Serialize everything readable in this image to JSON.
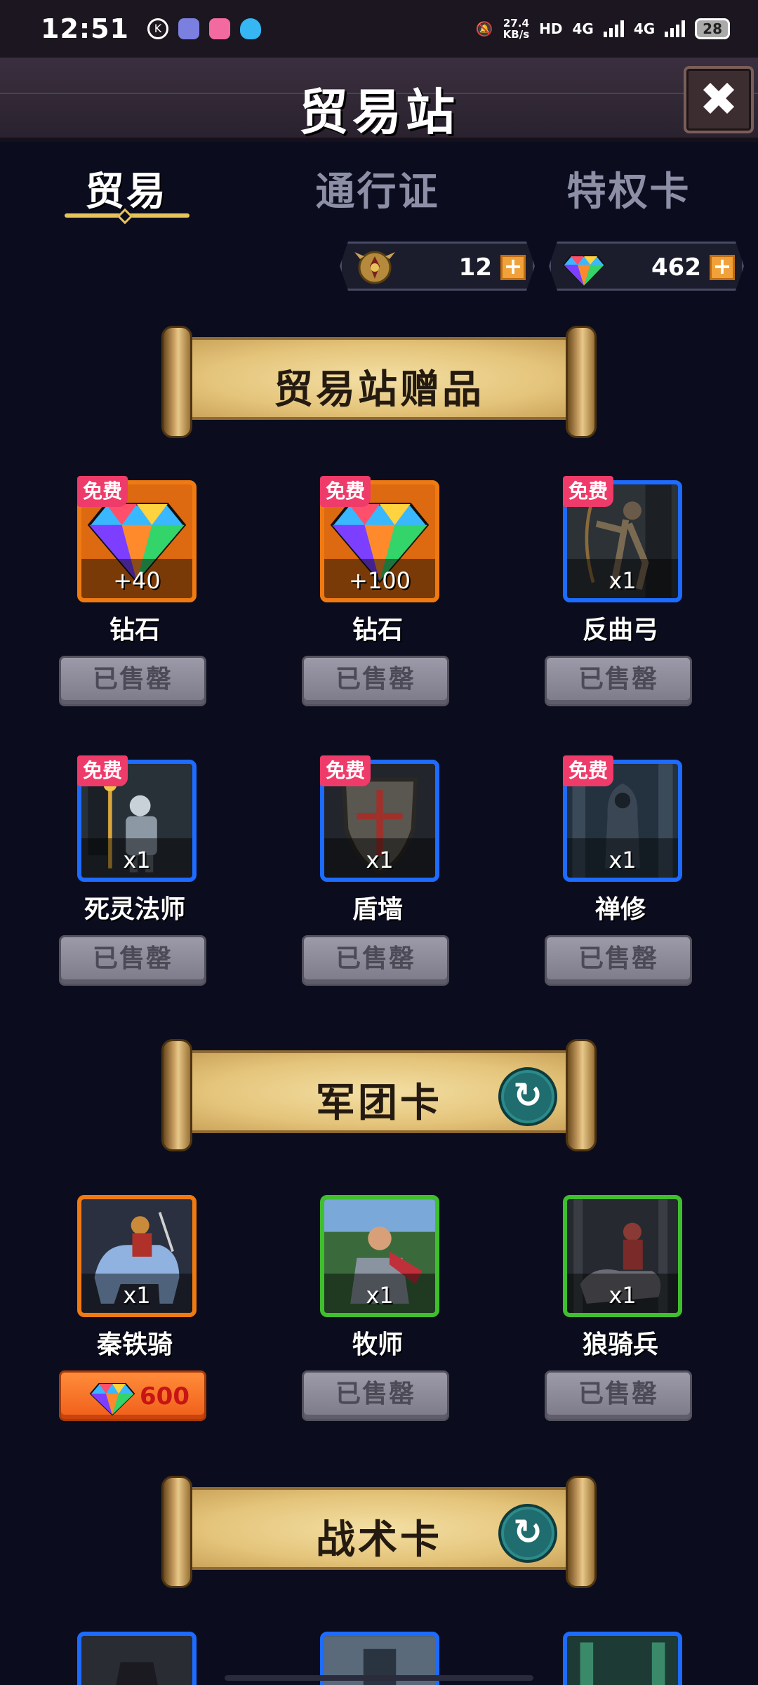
{
  "status_bar": {
    "time": "12:51",
    "speed_value": "27.4",
    "speed_unit": "KB/s",
    "hd_label": "HD",
    "net1": "4G",
    "net2": "4G",
    "battery": "28"
  },
  "header": {
    "title": "贸易站",
    "close_icon": "close-icon"
  },
  "tabs": [
    {
      "label": "贸易",
      "active": true
    },
    {
      "label": "通行证",
      "active": false
    },
    {
      "label": "特权卡",
      "active": false
    }
  ],
  "currency": {
    "medal": {
      "amount": "12",
      "icon": "medal-icon"
    },
    "gems": {
      "amount": "462",
      "icon": "gem-icon"
    },
    "plus_label": "+"
  },
  "sections": {
    "gifts": {
      "title": "贸易站赠品",
      "items": [
        {
          "name": "钻石",
          "qty": "+40",
          "tag": "免费",
          "action": "已售罄",
          "rarity": "orange",
          "icon": "gem-icon"
        },
        {
          "name": "钻石",
          "qty": "+100",
          "tag": "免费",
          "action": "已售罄",
          "rarity": "orange",
          "icon": "gem-icon"
        },
        {
          "name": "反曲弓",
          "qty": "x1",
          "tag": "免费",
          "action": "已售罄",
          "rarity": "blue",
          "icon": "archer-icon"
        },
        {
          "name": "死灵法师",
          "qty": "x1",
          "tag": "免费",
          "action": "已售罄",
          "rarity": "blue",
          "icon": "necromancer-icon"
        },
        {
          "name": "盾墙",
          "qty": "x1",
          "tag": "免费",
          "action": "已售罄",
          "rarity": "blue",
          "icon": "shield-icon"
        },
        {
          "name": "禅修",
          "qty": "x1",
          "tag": "免费",
          "action": "已售罄",
          "rarity": "blue",
          "icon": "monk-icon"
        }
      ]
    },
    "legion": {
      "title": "军团卡",
      "items": [
        {
          "name": "秦铁骑",
          "qty": "x1",
          "price": "600",
          "rarity": "orange",
          "icon": "cavalry-icon"
        },
        {
          "name": "牧师",
          "qty": "x1",
          "action": "已售罄",
          "rarity": "green",
          "icon": "priest-icon"
        },
        {
          "name": "狼骑兵",
          "qty": "x1",
          "action": "已售罄",
          "rarity": "green",
          "icon": "wolf-rider-icon"
        }
      ]
    },
    "tactics": {
      "title": "战术卡",
      "items": [
        {
          "rarity": "blue",
          "icon": "tactic-card-icon"
        },
        {
          "rarity": "blue",
          "icon": "tactic-card-icon"
        },
        {
          "rarity": "blue",
          "icon": "tactic-card-icon"
        }
      ]
    }
  },
  "colors": {
    "background": "#0b0d1f",
    "orange_rarity": "#f07a12",
    "blue_rarity": "#1d6bff",
    "green_rarity": "#3fbf2e",
    "free_tag": "#ef3b6a",
    "gold_accent": "#e8c35a"
  }
}
